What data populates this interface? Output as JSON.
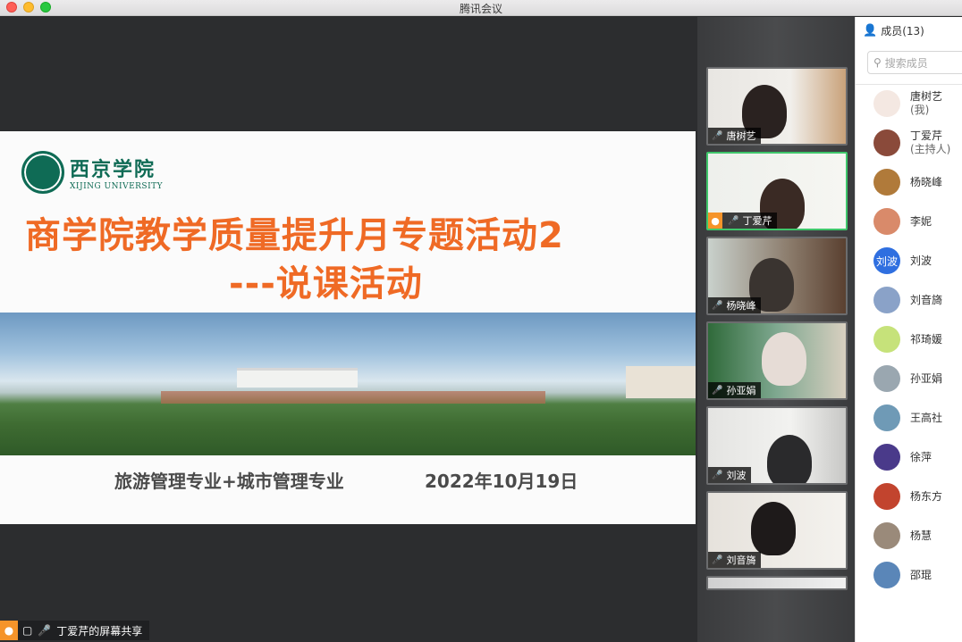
{
  "window": {
    "title": "腾讯会议"
  },
  "slide": {
    "logo_cn": "西京学院",
    "logo_en": "XIJING UNIVERSITY",
    "title_line1": "商学院教学质量提升月专题活动2",
    "title_line2": "---说课活动",
    "subtitle": "旅游管理专业+城市管理专业",
    "date": "2022年10月19日"
  },
  "sharer": {
    "label": "丁爱芹的屏幕共享"
  },
  "videos": [
    {
      "name": "唐树艺",
      "muted": false,
      "host": false,
      "active": false
    },
    {
      "name": "丁爱芹",
      "muted": false,
      "host": true,
      "active": true
    },
    {
      "name": "杨晓峰",
      "muted": false,
      "host": false,
      "active": false
    },
    {
      "name": "孙亚娟",
      "muted": true,
      "host": false,
      "active": false
    },
    {
      "name": "刘波",
      "muted": true,
      "host": false,
      "active": false
    },
    {
      "name": "刘音旖",
      "muted": true,
      "host": false,
      "active": false
    }
  ],
  "members": {
    "header": "成员(13)",
    "search_placeholder": "搜索成员",
    "list": [
      {
        "name": "唐树艺",
        "role": "(我)",
        "avatar_color": "#f4e8e2",
        "avatar_text": ""
      },
      {
        "name": "丁爱芹",
        "role": "(主持人)",
        "avatar_color": "#8a4a3a",
        "avatar_text": ""
      },
      {
        "name": "杨晓峰",
        "role": "",
        "avatar_color": "#b07a3a",
        "avatar_text": ""
      },
      {
        "name": "李妮",
        "role": "",
        "avatar_color": "#d98a6a",
        "avatar_text": ""
      },
      {
        "name": "刘波",
        "role": "",
        "avatar_color": "#2f6fe0",
        "avatar_text": "刘波"
      },
      {
        "name": "刘音旖",
        "role": "",
        "avatar_color": "#8aa2c8",
        "avatar_text": ""
      },
      {
        "name": "祁琦媛",
        "role": "",
        "avatar_color": "#c6e27a",
        "avatar_text": ""
      },
      {
        "name": "孙亚娟",
        "role": "",
        "avatar_color": "#9aa7b0",
        "avatar_text": ""
      },
      {
        "name": "王高社",
        "role": "",
        "avatar_color": "#6f9ab6",
        "avatar_text": ""
      },
      {
        "name": "徐萍",
        "role": "",
        "avatar_color": "#4a3a8a",
        "avatar_text": ""
      },
      {
        "name": "杨东方",
        "role": "",
        "avatar_color": "#c2442e",
        "avatar_text": ""
      },
      {
        "name": "杨慧",
        "role": "",
        "avatar_color": "#9a8a7a",
        "avatar_text": ""
      },
      {
        "name": "邵琨",
        "role": "",
        "avatar_color": "#5a86b8",
        "avatar_text": ""
      }
    ]
  }
}
